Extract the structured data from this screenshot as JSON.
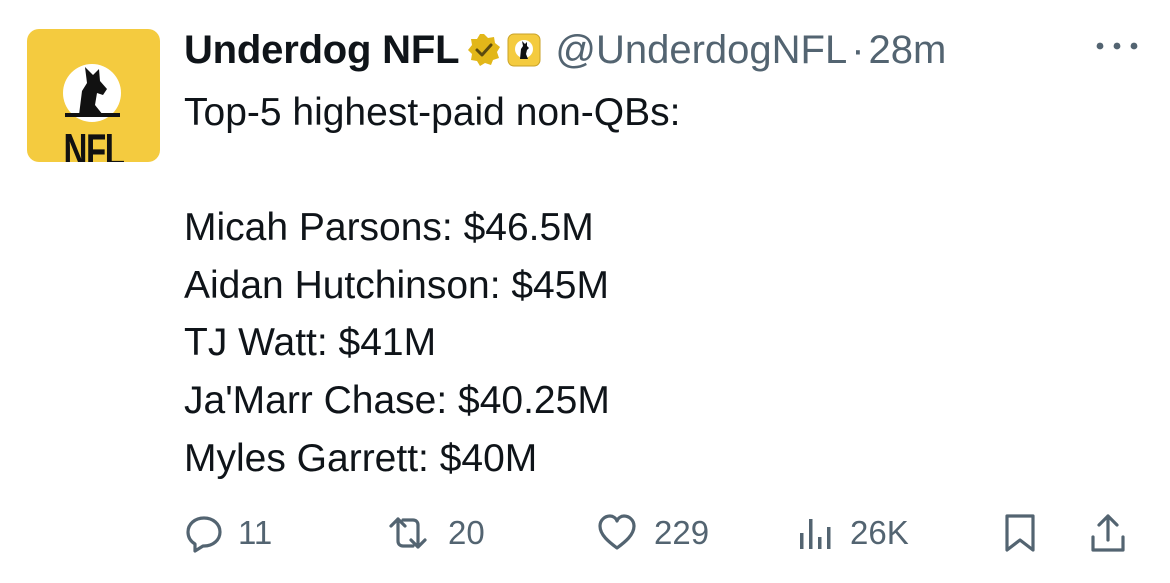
{
  "account": {
    "display_name": "Underdog NFL",
    "handle": "@UnderdogNFL",
    "separator": "·",
    "time": "28m",
    "avatar_text": "NFL",
    "verified_icon": "verified-badge-icon",
    "affiliate_icon": "underdog-affiliate-icon"
  },
  "tweet": {
    "lines": [
      "Top-5 highest-paid non-QBs:",
      "",
      "Micah Parsons: $46.5M",
      "Aidan Hutchinson: $45M",
      "TJ Watt: $41M",
      "Ja'Marr Chase: $40.25M",
      "Myles Garrett: $40M"
    ]
  },
  "actions": {
    "replies": "11",
    "reposts": "20",
    "likes": "229",
    "views": "26K"
  },
  "colors": {
    "text": "#0f1419",
    "secondary": "#536471",
    "brand_yellow": "#f4cb3f",
    "verified_gold": "#e2b719"
  }
}
